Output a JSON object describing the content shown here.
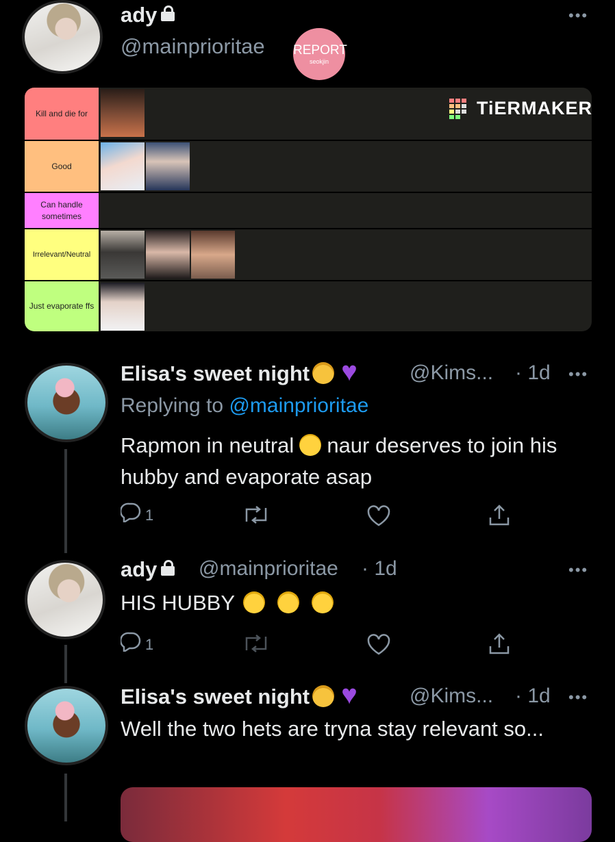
{
  "top_tweet": {
    "name": "ady",
    "handle": "@mainprioritae",
    "report_badge": {
      "title": "REPORT",
      "subtitle": "seokjin"
    }
  },
  "tier_list": {
    "brand": "TiERMAKER",
    "rows": [
      {
        "label": "Kill and die for",
        "color": "#ff7f7f",
        "items": 1
      },
      {
        "label": "Good",
        "color": "#ffbf7f",
        "items": 2
      },
      {
        "label": "Can handle sometimes",
        "color": "#ff7fff",
        "items": 0
      },
      {
        "label": "Irrelevant/Neutral",
        "color": "#ffff7f",
        "items": 3
      },
      {
        "label": "Just evaporate ffs",
        "color": "#bfff7f",
        "items": 1
      }
    ]
  },
  "reply1": {
    "name": "Elisa's sweet night",
    "handle": "@Kims...",
    "time": "· 1d",
    "replying_prefix": "Replying to",
    "replying_to": "@mainprioritae",
    "text_part1": "Rapmon in neutral",
    "text_part2": "naur deserves to join his hubby and evaporate asap",
    "reply_count": "1"
  },
  "reply2": {
    "name": "ady",
    "handle": "@mainprioritae",
    "time": "· 1d",
    "text": "HIS HUBBY",
    "reply_count": "1"
  },
  "reply3": {
    "name": "Elisa's sweet night",
    "handle": "@Kims...",
    "time": "· 1d",
    "text": "Well the two hets are tryna stay relevant so..."
  },
  "icons": {
    "reply": "reply-icon",
    "retweet": "retweet-icon",
    "like": "heart-icon",
    "share": "share-icon",
    "more": "more-dots-icon"
  }
}
